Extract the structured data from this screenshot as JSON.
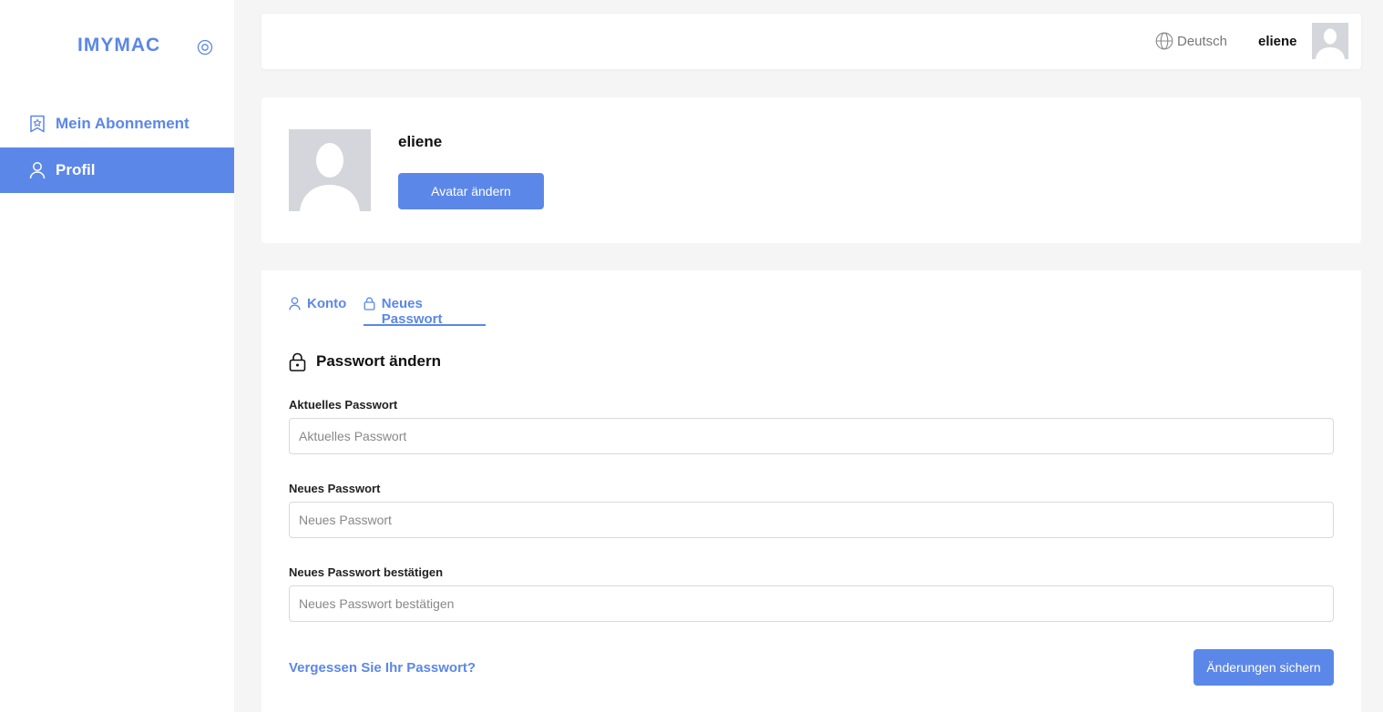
{
  "sidebar": {
    "logo": "IMYMAC",
    "items": [
      {
        "label": "Mein Abonnement",
        "icon": "bookmark-star-icon",
        "active": false
      },
      {
        "label": "Profil",
        "icon": "user-icon",
        "active": true
      }
    ]
  },
  "header": {
    "language": "Deutsch",
    "username": "eliene"
  },
  "profile": {
    "name": "eliene",
    "change_avatar_label": "Avatar ändern"
  },
  "tabs": [
    {
      "label": "Konto",
      "icon": "user-icon",
      "active": false
    },
    {
      "label": "Neues Passwort",
      "icon": "lock-icon",
      "active": true
    }
  ],
  "form": {
    "title": "Passwort ändern",
    "fields": [
      {
        "label": "Aktuelles Passwort",
        "placeholder": "Aktuelles Passwort",
        "value": ""
      },
      {
        "label": "Neues Passwort",
        "placeholder": "Neues Passwort",
        "value": ""
      },
      {
        "label": "Neues Passwort bestätigen",
        "placeholder": "Neues Passwort bestätigen",
        "value": ""
      }
    ],
    "forgot_label": "Vergessen Sie Ihr Passwort?",
    "save_label": "Änderungen sichern"
  },
  "colors": {
    "accent": "#5b87e8",
    "background": "#f5f5f5",
    "avatar_placeholder": "#d4d6db"
  }
}
